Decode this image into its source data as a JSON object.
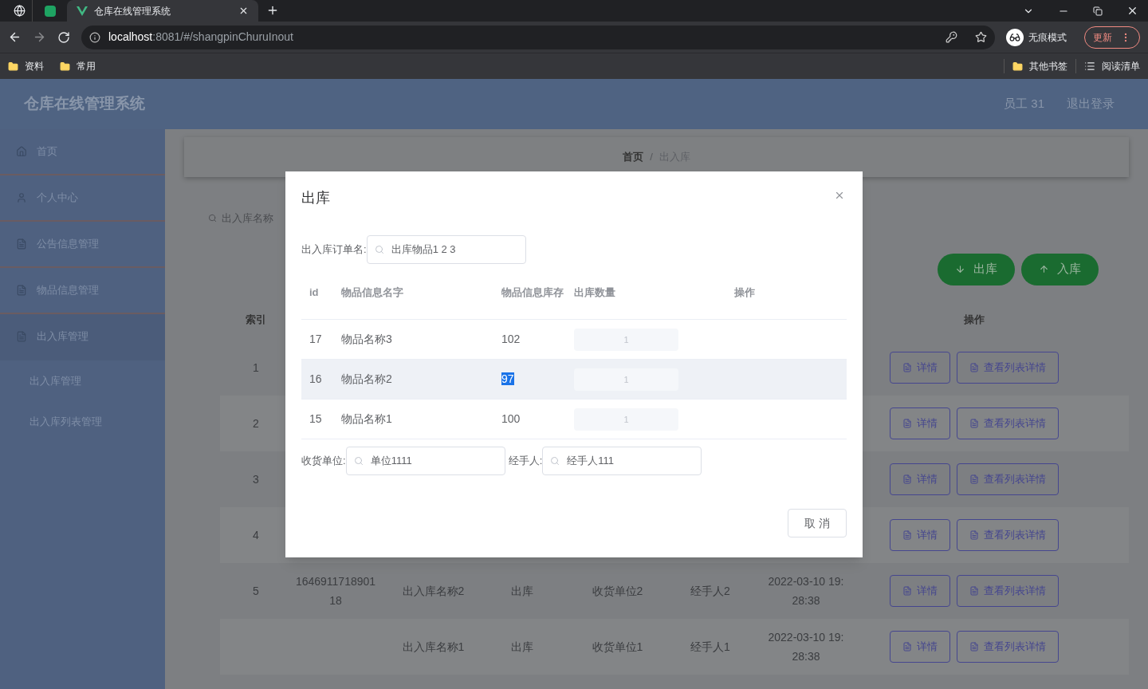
{
  "browser": {
    "tabs": [
      {
        "kind": "icon",
        "selected": false
      },
      {
        "kind": "sheet",
        "selected": false
      },
      {
        "kind": "page",
        "title": "仓库在线管理系统",
        "selected": true
      }
    ],
    "url_host": "localhost",
    "url_path": ":8081/#/shangpinChuruInout",
    "incognito": "无痕模式",
    "update": "更新",
    "bookmarks": [
      "资料",
      "常用"
    ],
    "other_bookmarks": "其他书签",
    "reading_list": "阅读清单"
  },
  "header": {
    "title": "仓库在线管理系统",
    "user": "员工 31",
    "logout": "退出登录"
  },
  "sidebar": {
    "items": [
      {
        "label": "首页",
        "kind": "home"
      },
      {
        "label": "个人中心",
        "kind": "user"
      },
      {
        "label": "公告信息管理",
        "kind": "doc"
      },
      {
        "label": "物品信息管理",
        "kind": "doc"
      },
      {
        "label": "出入库管理",
        "kind": "doc",
        "expanded": true,
        "children": [
          {
            "label": "出入库管理"
          },
          {
            "label": "出入库列表管理"
          }
        ]
      }
    ]
  },
  "breadcrumb": [
    "首页",
    "出入库"
  ],
  "breadcrumb_separator": "/",
  "search_label": "出入库名称",
  "actions": [
    {
      "label": "出库",
      "kind": "out"
    },
    {
      "label": "入库",
      "kind": "in"
    }
  ],
  "table": {
    "columns": [
      "索引",
      "",
      "",
      "",
      "",
      "",
      "",
      "操作"
    ],
    "rows": [
      {
        "cells": [
          "1"
        ],
        "buttons": [
          "详情",
          "查看列表详情"
        ]
      },
      {
        "cells": [
          "2"
        ],
        "buttons": [
          "详情",
          "查看列表详情"
        ]
      },
      {
        "cells": [
          "3"
        ],
        "buttons": [
          "详情",
          "查看列表详情"
        ]
      },
      {
        "cells": [
          "4"
        ],
        "buttons": [
          "详情",
          "查看列表详情"
        ]
      },
      {
        "cells": [
          "5",
          "164691171890118",
          "出入库名称2",
          "出库",
          "收货单位2",
          "经手人2",
          "2022-03-10 19:28:38"
        ],
        "buttons": [
          "详情",
          "查看列表详情"
        ]
      },
      {
        "cells": [
          "",
          "",
          "出入库名称1",
          "出库",
          "收货单位1",
          "经手人1",
          "2022-03-10 19:28:38"
        ],
        "buttons": [
          "详情",
          "查看列表详情"
        ]
      }
    ]
  },
  "modal": {
    "title": "出库",
    "order_label": "出入库订单名:",
    "order_value": "出库物品1 2 3",
    "columns": [
      "id",
      "物品信息名字",
      "物品信息库存",
      "出库数量",
      "操作"
    ],
    "rows": [
      {
        "id": "17",
        "name": "物品名称3",
        "stock": "102",
        "qty": "1",
        "hovered": false,
        "stock_selected": false
      },
      {
        "id": "16",
        "name": "物品名称2",
        "stock": "97",
        "qty": "1",
        "hovered": true,
        "stock_selected": true
      },
      {
        "id": "15",
        "name": "物品名称1",
        "stock": "100",
        "qty": "1",
        "hovered": false,
        "stock_selected": false
      }
    ],
    "unit_label": "收货单位:",
    "unit_value": "单位1111",
    "handler_label": "经手人:",
    "handler_value": "经手人111",
    "cancel": "取 消"
  }
}
